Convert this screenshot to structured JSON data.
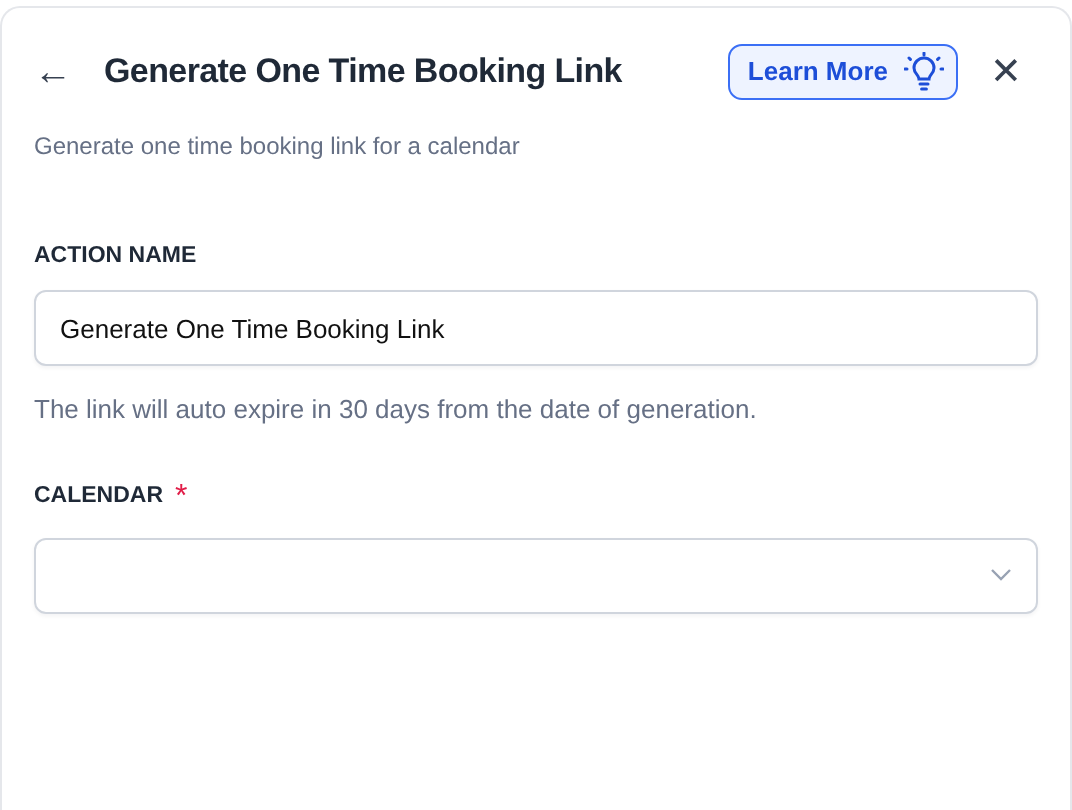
{
  "header": {
    "back": "←",
    "title": "Generate One Time Booking Link",
    "learn_more": "Learn More",
    "close": "✕"
  },
  "subtitle": "Generate one time booking link for a calendar",
  "fields": [
    {
      "kind": "text",
      "label": "ACTION NAME",
      "value": "Generate One Time Booking Link",
      "help": "The link will auto expire in 30 days from the date of generation."
    },
    {
      "kind": "select",
      "label": "CALENDAR",
      "required_mark": "*"
    }
  ]
}
